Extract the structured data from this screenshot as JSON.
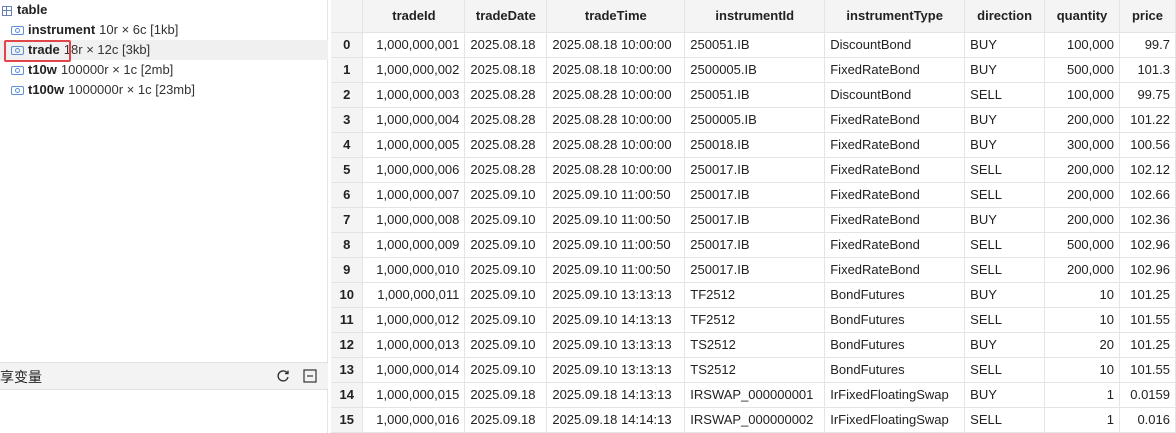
{
  "tree": {
    "root_label": "table",
    "items": [
      {
        "name": "instrument",
        "meta": "10r × 6c [1kb]"
      },
      {
        "name": "trade",
        "meta": "18r × 12c [3kb]"
      },
      {
        "name": "t10w",
        "meta": "100000r × 1c [2mb]"
      },
      {
        "name": "t100w",
        "meta": "1000000r × 1c [23mb]"
      }
    ]
  },
  "shared_panel": {
    "title": "享变量"
  },
  "icons": {
    "refresh": "refresh-icon",
    "collapse": "collapse-icon",
    "variable": "variable-icon",
    "table": "table-icon"
  },
  "colors": {
    "highlight": "#e0454b"
  },
  "grid": {
    "columns": [
      "tradeId",
      "tradeDate",
      "tradeTime",
      "instrumentId",
      "instrumentType",
      "direction",
      "quantity",
      "price"
    ],
    "rows": [
      {
        "idx": "0",
        "cells": [
          "1,000,000,001",
          "2025.08.18",
          "2025.08.18 10:00:00",
          "250051.IB",
          "DiscountBond",
          "BUY",
          "100,000",
          "99.7"
        ]
      },
      {
        "idx": "1",
        "cells": [
          "1,000,000,002",
          "2025.08.18",
          "2025.08.18 10:00:00",
          "2500005.IB",
          "FixedRateBond",
          "BUY",
          "500,000",
          "101.3"
        ]
      },
      {
        "idx": "2",
        "cells": [
          "1,000,000,003",
          "2025.08.28",
          "2025.08.28 10:00:00",
          "250051.IB",
          "DiscountBond",
          "SELL",
          "100,000",
          "99.75"
        ]
      },
      {
        "idx": "3",
        "cells": [
          "1,000,000,004",
          "2025.08.28",
          "2025.08.28 10:00:00",
          "2500005.IB",
          "FixedRateBond",
          "BUY",
          "200,000",
          "101.22"
        ]
      },
      {
        "idx": "4",
        "cells": [
          "1,000,000,005",
          "2025.08.28",
          "2025.08.28 10:00:00",
          "250018.IB",
          "FixedRateBond",
          "BUY",
          "300,000",
          "100.56"
        ]
      },
      {
        "idx": "5",
        "cells": [
          "1,000,000,006",
          "2025.08.28",
          "2025.08.28 10:00:00",
          "250017.IB",
          "FixedRateBond",
          "SELL",
          "200,000",
          "102.12"
        ]
      },
      {
        "idx": "6",
        "cells": [
          "1,000,000,007",
          "2025.09.10",
          "2025.09.10 11:00:50",
          "250017.IB",
          "FixedRateBond",
          "SELL",
          "200,000",
          "102.66"
        ]
      },
      {
        "idx": "7",
        "cells": [
          "1,000,000,008",
          "2025.09.10",
          "2025.09.10 11:00:50",
          "250017.IB",
          "FixedRateBond",
          "BUY",
          "200,000",
          "102.36"
        ]
      },
      {
        "idx": "8",
        "cells": [
          "1,000,000,009",
          "2025.09.10",
          "2025.09.10 11:00:50",
          "250017.IB",
          "FixedRateBond",
          "SELL",
          "500,000",
          "102.96"
        ]
      },
      {
        "idx": "9",
        "cells": [
          "1,000,000,010",
          "2025.09.10",
          "2025.09.10 11:00:50",
          "250017.IB",
          "FixedRateBond",
          "SELL",
          "200,000",
          "102.96"
        ]
      },
      {
        "idx": "10",
        "cells": [
          "1,000,000,011",
          "2025.09.10",
          "2025.09.10 13:13:13",
          "TF2512",
          "BondFutures",
          "BUY",
          "10",
          "101.25"
        ]
      },
      {
        "idx": "11",
        "cells": [
          "1,000,000,012",
          "2025.09.10",
          "2025.09.10 14:13:13",
          "TF2512",
          "BondFutures",
          "SELL",
          "10",
          "101.55"
        ]
      },
      {
        "idx": "12",
        "cells": [
          "1,000,000,013",
          "2025.09.10",
          "2025.09.10 13:13:13",
          "TS2512",
          "BondFutures",
          "BUY",
          "20",
          "101.25"
        ]
      },
      {
        "idx": "13",
        "cells": [
          "1,000,000,014",
          "2025.09.10",
          "2025.09.10 13:13:13",
          "TS2512",
          "BondFutures",
          "SELL",
          "10",
          "101.55"
        ]
      },
      {
        "idx": "14",
        "cells": [
          "1,000,000,015",
          "2025.09.18",
          "2025.09.18 14:13:13",
          "IRSWAP_000000001",
          "IrFixedFloatingSwap",
          "BUY",
          "1",
          "0.0159"
        ]
      },
      {
        "idx": "15",
        "cells": [
          "1,000,000,016",
          "2025.09.18",
          "2025.09.18 14:14:13",
          "IRSWAP_000000002",
          "IrFixedFloatingSwap",
          "SELL",
          "1",
          "0.016"
        ]
      }
    ]
  }
}
